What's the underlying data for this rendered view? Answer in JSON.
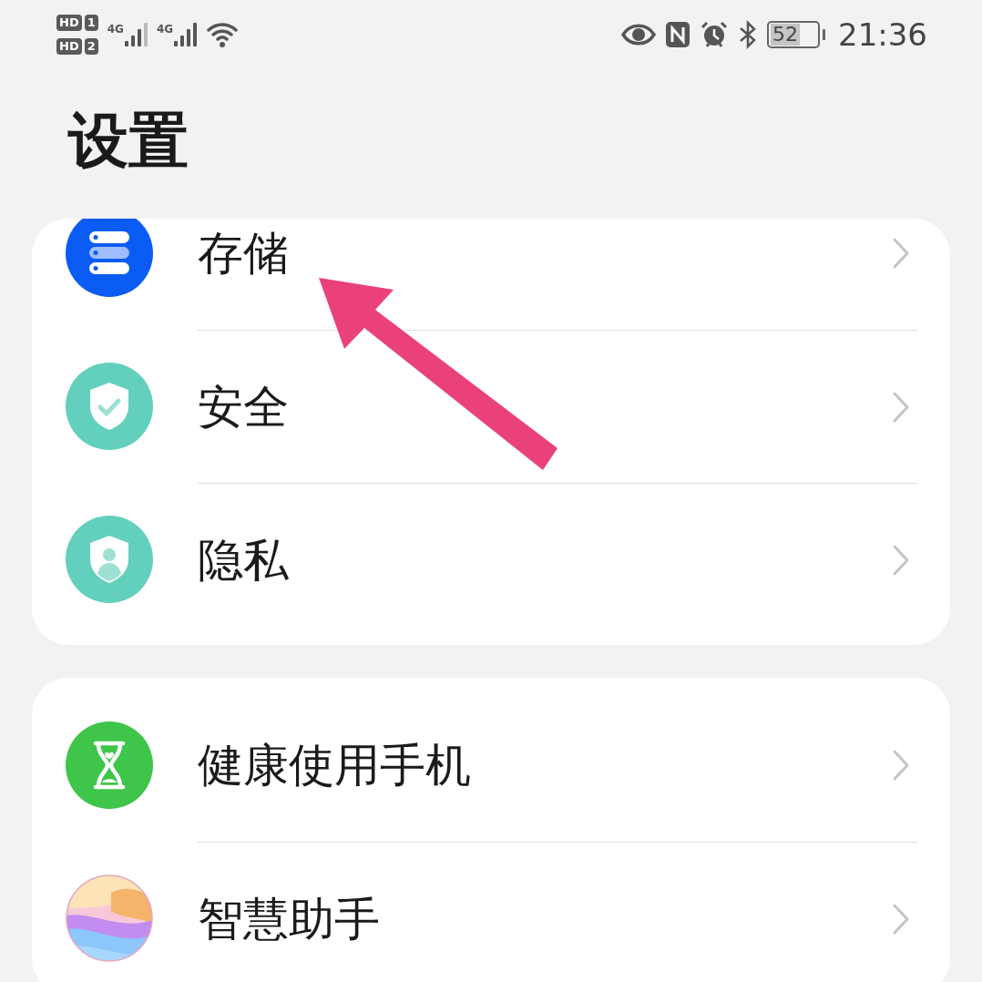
{
  "status_bar": {
    "sims": [
      {
        "badge": "HD",
        "slot": "1"
      },
      {
        "badge": "HD",
        "slot": "2"
      }
    ],
    "networks": [
      "4G",
      "4G"
    ],
    "battery": "52",
    "time": "21:36"
  },
  "title": "设置",
  "groups": [
    {
      "items": [
        {
          "label": "存储"
        },
        {
          "label": "安全"
        },
        {
          "label": "隐私"
        }
      ]
    },
    {
      "items": [
        {
          "label": "健康使用手机"
        },
        {
          "label": "智慧助手"
        }
      ]
    }
  ]
}
